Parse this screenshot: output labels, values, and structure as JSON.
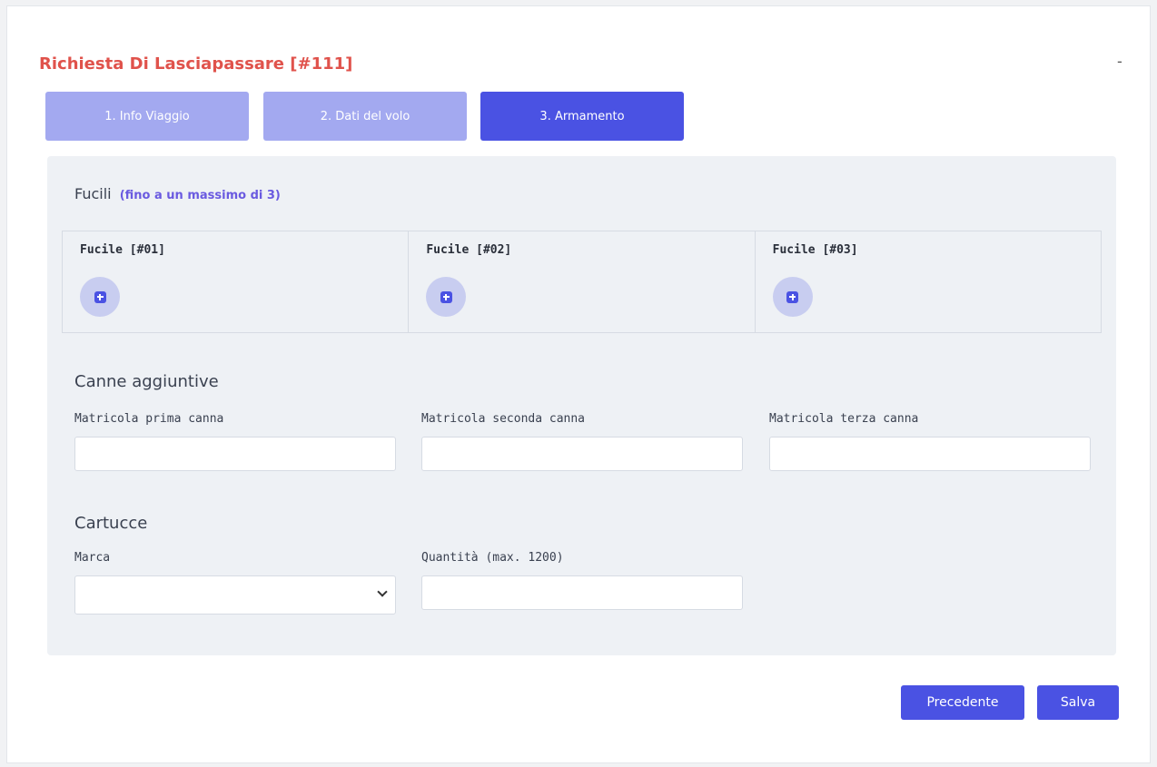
{
  "header": {
    "title": "Richiesta Di Lasciapassare [#111]",
    "collapse_label": "-"
  },
  "steps": [
    {
      "label": "1. Info Viaggio",
      "active": false
    },
    {
      "label": "2. Dati del volo",
      "active": false
    },
    {
      "label": "3. Armamento",
      "active": true
    }
  ],
  "fucili": {
    "title": "Fucili",
    "note": "(fino a un massimo di 3)",
    "items": [
      {
        "label": "Fucile [#01]"
      },
      {
        "label": "Fucile [#02]"
      },
      {
        "label": "Fucile [#03]"
      }
    ]
  },
  "canne": {
    "title": "Canne aggiuntive",
    "fields": [
      {
        "label": "Matricola prima canna",
        "value": "",
        "placeholder": ""
      },
      {
        "label": "Matricola seconda canna",
        "value": "",
        "placeholder": ""
      },
      {
        "label": "Matricola terza canna",
        "value": "",
        "placeholder": ""
      }
    ]
  },
  "cartucce": {
    "title": "Cartucce",
    "marca_label": "Marca",
    "marca_value": "",
    "quantita_label": "Quantità (max. 1200)",
    "quantita_value": ""
  },
  "actions": {
    "previous_label": "Precedente",
    "save_label": "Salva"
  },
  "colors": {
    "accent": "#4a52e3",
    "accent_light": "#a3a9f0",
    "title_red": "#e0524b",
    "note_purple": "#6a5ae0",
    "panel_bg": "#eef1f5"
  },
  "icons": {
    "add": "plus-square-icon",
    "dropdown": "chevron-down-icon"
  }
}
